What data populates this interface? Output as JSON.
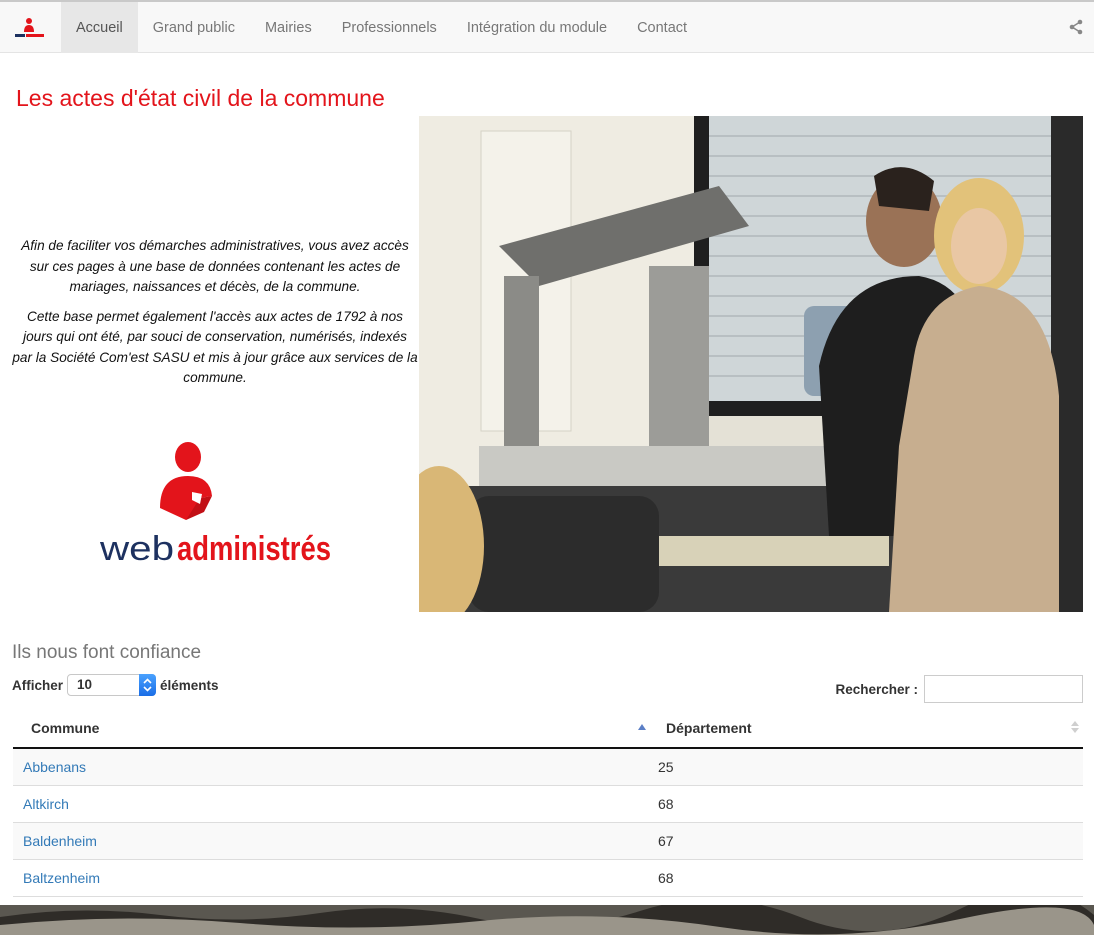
{
  "navbar": {
    "brand_icon": "web-administres-small-logo",
    "items": [
      {
        "label": "Accueil",
        "active": true
      },
      {
        "label": "Grand public",
        "active": false
      },
      {
        "label": "Mairies",
        "active": false
      },
      {
        "label": "Professionnels",
        "active": false
      },
      {
        "label": "Intégration du module",
        "active": false
      },
      {
        "label": "Contact",
        "active": false
      }
    ],
    "share_icon": "share-icon"
  },
  "hero": {
    "title": "Les actes d'état civil de la commune",
    "paragraphs": [
      "Afin de faciliter vos démarches administratives, vous avez accès sur ces pages à une base de données contenant les actes de mariages, naissances et décès, de la commune.",
      "Cette base permet également l'accès aux actes de 1792 à nos jours qui ont été, par souci de conservation, numérisés, indexés par la Société Com'est SASU et mis à jour grâce aux services de la commune."
    ],
    "logo": {
      "part1": "web",
      "part2": "administrés"
    },
    "photo": "archive-scanner-photo"
  },
  "colors": {
    "accent": "#e3141b",
    "link": "#337ab7",
    "logo_blue": "#1d3160"
  },
  "table_section": {
    "title": "Ils nous font confiance",
    "length": {
      "prefix": "Afficher",
      "value": "10",
      "suffix": "éléments"
    },
    "search_label": "Rechercher :",
    "columns": [
      "Commune",
      "Département"
    ],
    "rows": [
      {
        "commune": "Abbenans",
        "dept": "25"
      },
      {
        "commune": "Altkirch",
        "dept": "68"
      },
      {
        "commune": "Baldenheim",
        "dept": "67"
      },
      {
        "commune": "Baltzenheim",
        "dept": "68"
      }
    ]
  }
}
